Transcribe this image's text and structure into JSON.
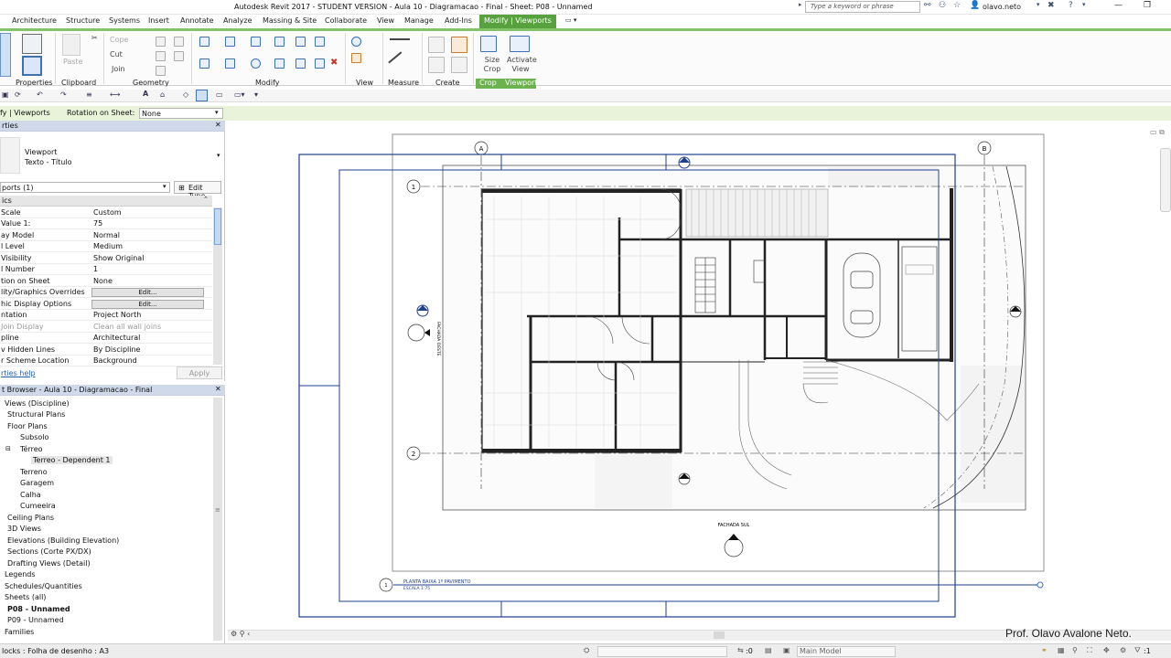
{
  "titlebar": {
    "title": "Autodesk Revit 2017 - STUDENT VERSION -    Aula 10 - Diagramacao - Final - Sheet: P08 - Unnamed",
    "search_placeholder": "Type a keyword or phrase",
    "user": "olavo.neto"
  },
  "tabs": [
    "Architecture",
    "Structure",
    "Systems",
    "Insert",
    "Annotate",
    "Analyze",
    "Massing & Site",
    "Collaborate",
    "View",
    "Manage",
    "Add-Ins",
    "Modify | Viewports"
  ],
  "ribbon": {
    "panels": [
      "Properties",
      "Clipboard",
      "Geometry",
      "Modify",
      "View",
      "Measure",
      "Create",
      "Crop",
      "Viewport"
    ],
    "clipboard": {
      "paste": "Paste",
      "copy": "Cope",
      "cut": "Cut",
      "join": "Join"
    },
    "crop": {
      "size_crop": "Size Crop"
    },
    "viewport": {
      "activate_view": "Activate View"
    }
  },
  "options_bar": {
    "context": "fy | Viewports",
    "rotation_label": "Rotation on Sheet:",
    "rotation_value": "None"
  },
  "properties": {
    "header": "rties",
    "type_name": "Viewport",
    "type_sub": "Texto - Título",
    "selector": "ports (1)",
    "edit_type": "Edit Type",
    "section": "ics",
    "rows": [
      {
        "k": "Scale",
        "v": "Custom"
      },
      {
        "k": "Value    1:",
        "v": "75"
      },
      {
        "k": "ay Model",
        "v": "Normal"
      },
      {
        "k": "l Level",
        "v": "Medium"
      },
      {
        "k": "Visibility",
        "v": "Show Original"
      },
      {
        "k": "l Number",
        "v": "1"
      },
      {
        "k": "tion on Sheet",
        "v": "None"
      },
      {
        "k": "lity/Graphics Overrides",
        "v": "Edit...",
        "btn": true
      },
      {
        "k": "hic Display Options",
        "v": "Edit...",
        "btn": true
      },
      {
        "k": "ntation",
        "v": "Project North"
      },
      {
        "k": "Join Display",
        "v": "Clean all wall joins",
        "dim": true
      },
      {
        "k": "pline",
        "v": "Architectural"
      },
      {
        "k": "v Hidden Lines",
        "v": "By Discipline"
      },
      {
        "k": "r Scheme Location",
        "v": "Background"
      }
    ],
    "help": "rties help",
    "apply": "Apply"
  },
  "browser": {
    "header": "t Browser - Aula 10 - Diagramacao - Final",
    "items": [
      "Views (Discipline)",
      "Structural Plans",
      "Floor Plans",
      "Subsolo",
      "Térreo",
      "Terreo - Dependent 1",
      "Terreno",
      "Garagem",
      "Calha",
      "Cumeeira",
      "Ceiling Plans",
      "3D Views",
      "Elevations (Building Elevation)",
      "Sections (Corte PX/DX)",
      "Drafting Views (Detail)",
      "Legends",
      "Schedules/Quantities",
      "Sheets (all)",
      "P08 - Unnamed",
      "P09 - Unnamed",
      "Families"
    ]
  },
  "drawing": {
    "grid_a": "A",
    "grid_b": "B",
    "grid_1": "1",
    "grid_2": "2",
    "view_title": "PLANTA BAIXA 1º PAVIMENTO",
    "view_scale": "ESCALA    1:75",
    "view_number": "1",
    "south_facade": "FACHADA SUL",
    "west_facade": "FACHADA OESTE"
  },
  "status": {
    "left": "locks : Folha de desenho : A3",
    "zero": ":0",
    "model": "Main Model",
    "filter": ":1"
  },
  "watermark": "Prof. Olavo Avalone Neto.",
  "colors": {
    "accent_green": "#57a23f",
    "ribbon_border": "#83c46a",
    "viewport_blue": "#1f3f8f"
  }
}
